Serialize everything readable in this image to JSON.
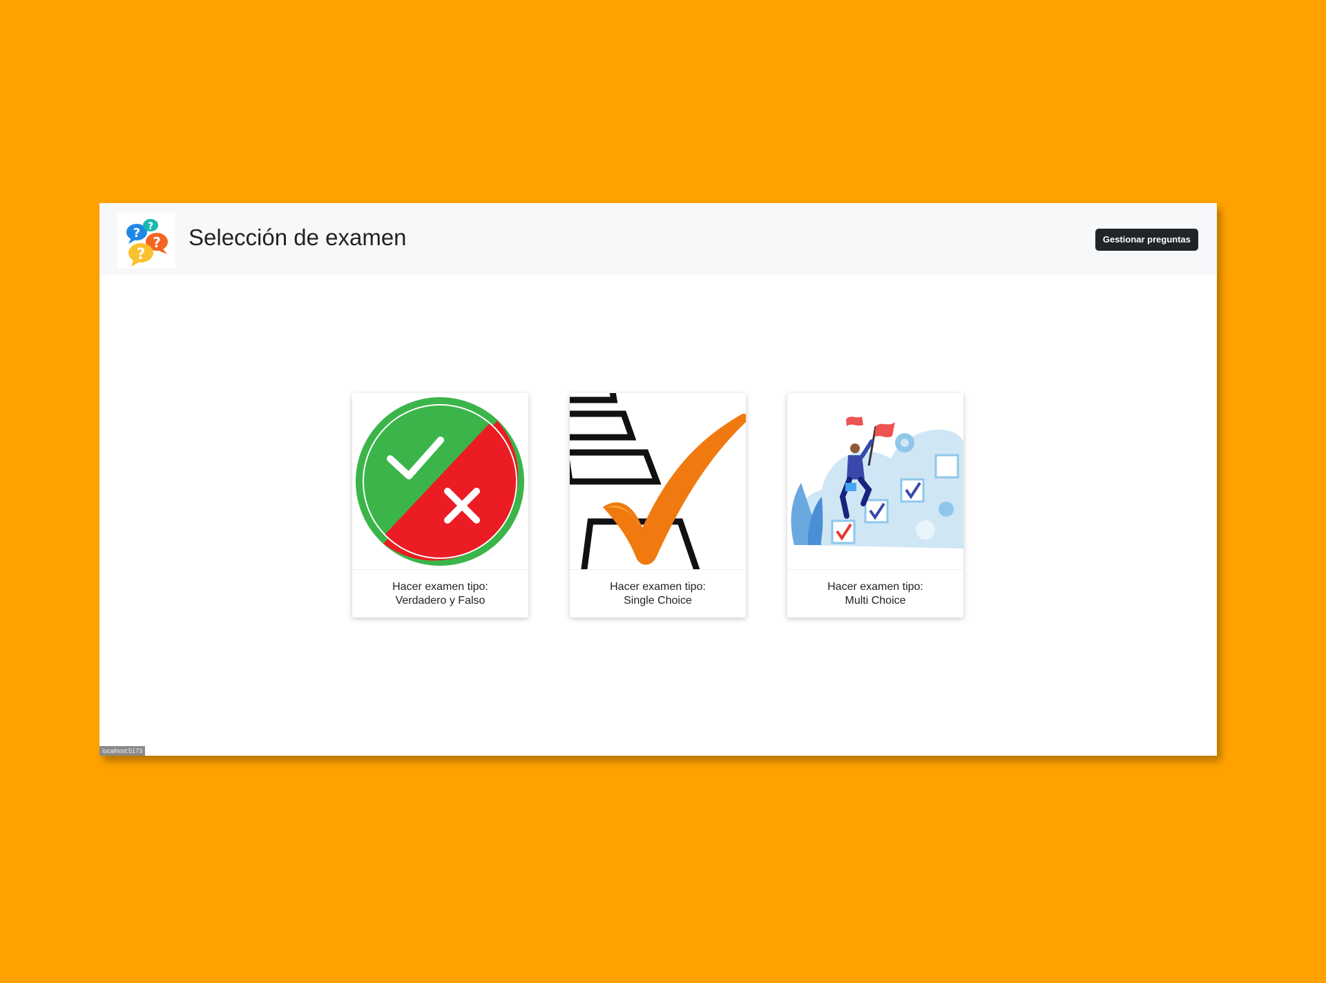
{
  "header": {
    "title": "Selección de examen",
    "manage_button": "Gestionar preguntas",
    "logo_icon": "question-bubbles-icon"
  },
  "cards": [
    {
      "line1": "Hacer examen tipo:",
      "line2": "Verdadero y Falso",
      "icon": "true-false-icon"
    },
    {
      "line1": "Hacer examen tipo:",
      "line2": "Single Choice",
      "icon": "checkmark-checkboxes-icon"
    },
    {
      "line1": "Hacer examen tipo:",
      "line2": "Multi Choice",
      "icon": "multi-choice-climber-icon"
    }
  ],
  "status_bar": {
    "url": "localhost:5173"
  },
  "colors": {
    "background": "#FFA200",
    "navbar": "#f7f8f9",
    "button": "#212529",
    "green": "#3bb54a",
    "red": "#ec1c24",
    "orange_check": "#f07a10"
  }
}
